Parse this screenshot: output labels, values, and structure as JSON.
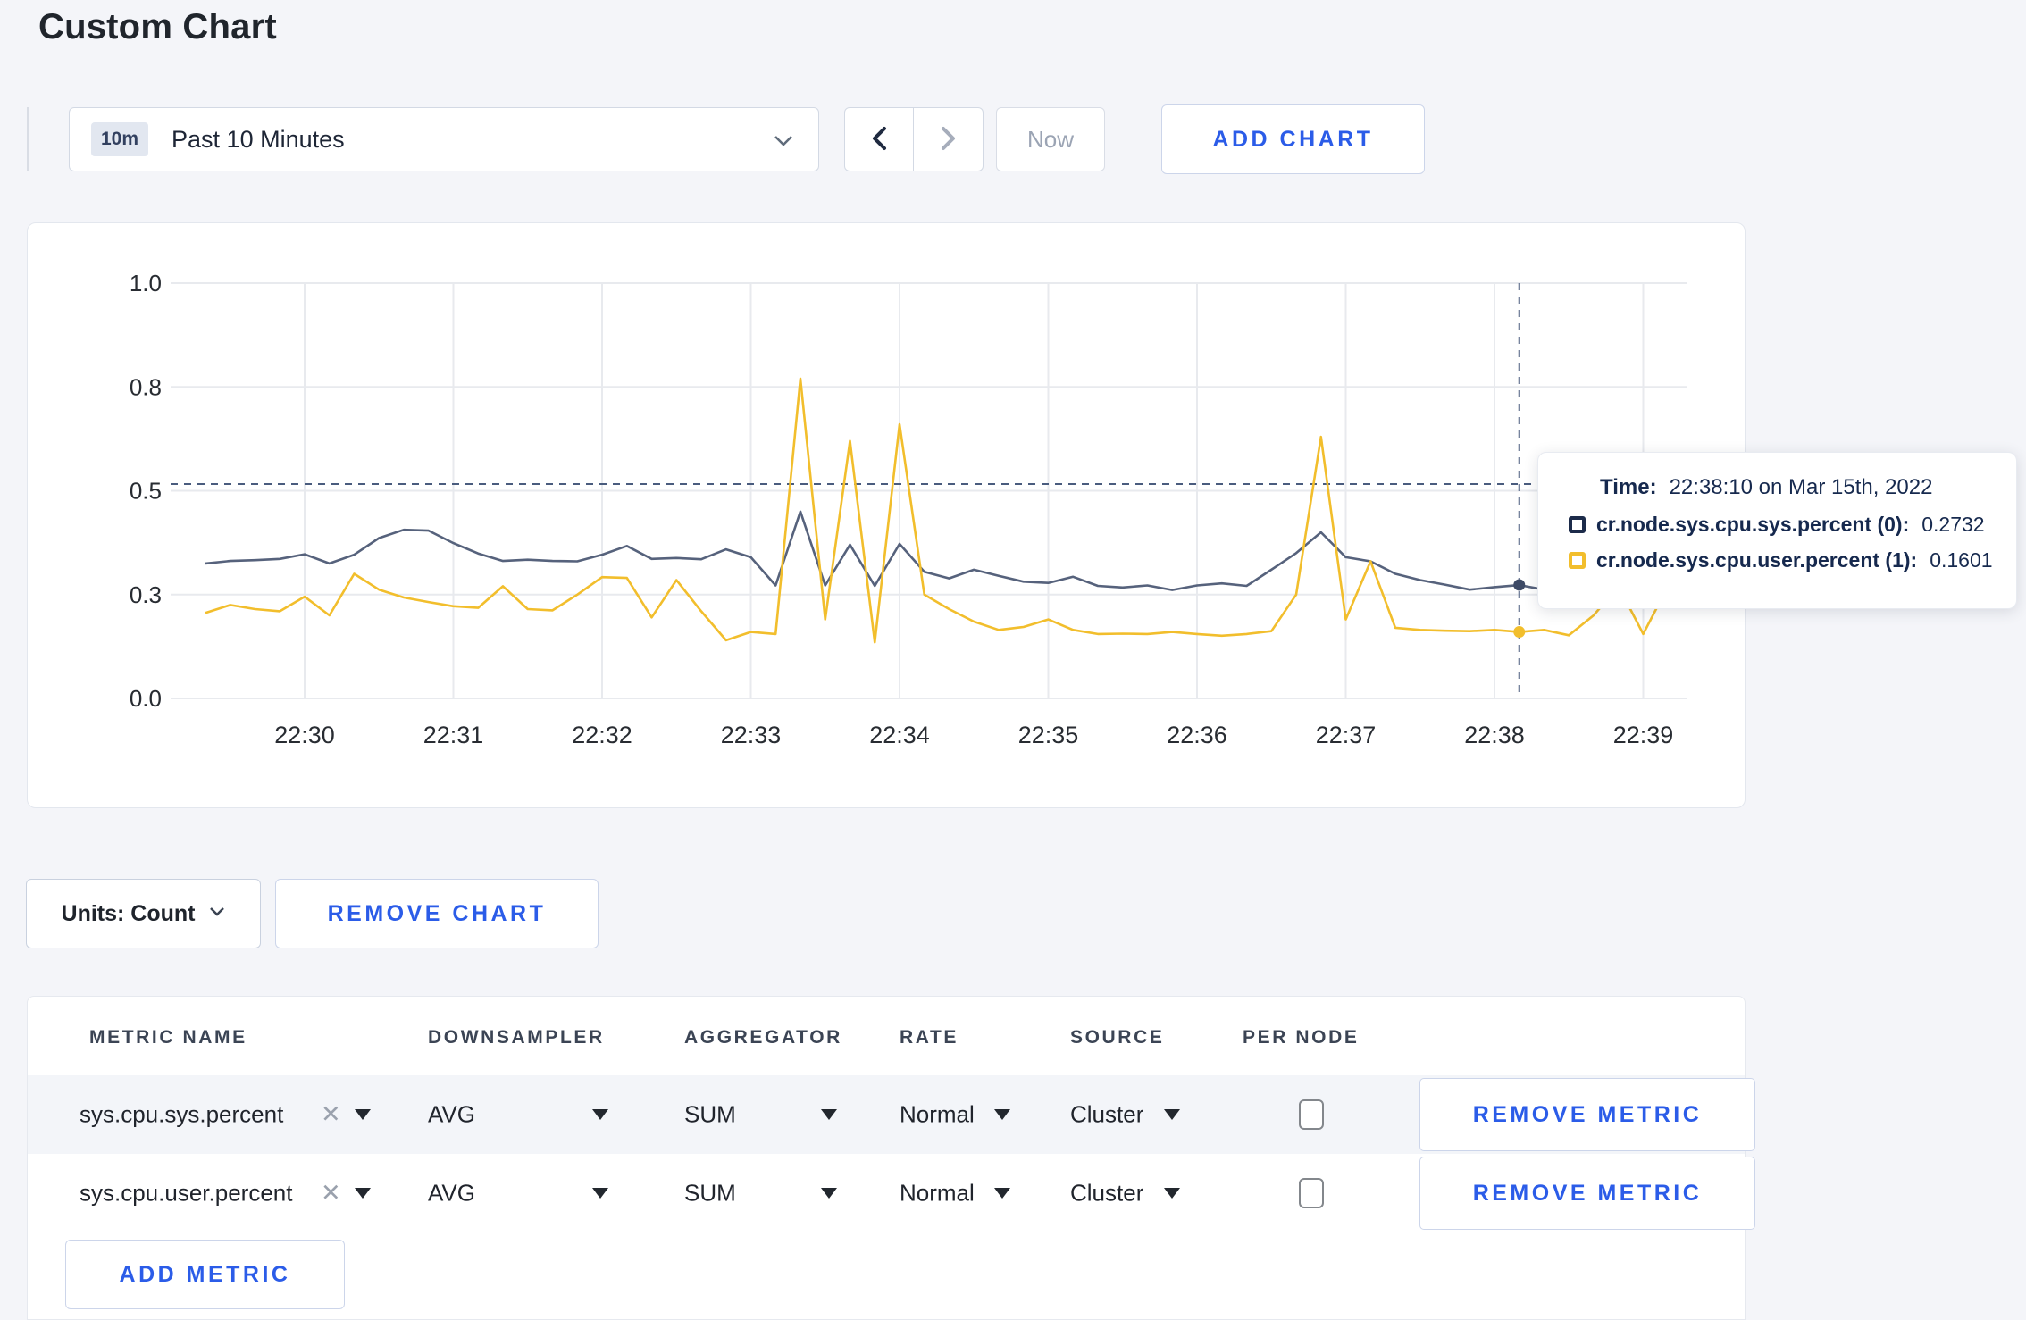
{
  "page": {
    "title": "Custom Chart"
  },
  "toolbar": {
    "time_badge": "10m",
    "time_label": "Past 10 Minutes",
    "now_label": "Now",
    "add_chart_label": "ADD CHART"
  },
  "tooltip": {
    "time_label": "Time:",
    "time_value": "22:38:10 on Mar 15th, 2022",
    "rows": [
      {
        "name": "cr.node.sys.cpu.sys.percent (0):",
        "value": "0.2732",
        "color": "#1c2b4a"
      },
      {
        "name": "cr.node.sys.cpu.user.percent (1):",
        "value": "0.1601",
        "color": "#f2be2c"
      }
    ]
  },
  "chart_footer": {
    "units_label": "Units: Count",
    "remove_chart_label": "REMOVE CHART"
  },
  "table": {
    "headers": [
      "METRIC NAME",
      "DOWNSAMPLER",
      "AGGREGATOR",
      "RATE",
      "SOURCE",
      "PER NODE"
    ],
    "rows": [
      {
        "metric": "sys.cpu.sys.percent",
        "remove_x": "✕",
        "downsampler": "AVG",
        "aggregator": "SUM",
        "rate": "Normal",
        "source": "Cluster",
        "per_node_checked": false,
        "remove_label": "REMOVE METRIC"
      },
      {
        "metric": "sys.cpu.user.percent",
        "remove_x": "✕",
        "downsampler": "AVG",
        "aggregator": "SUM",
        "rate": "Normal",
        "source": "Cluster",
        "per_node_checked": false,
        "remove_label": "REMOVE METRIC"
      }
    ],
    "add_metric_label": "ADD METRIC"
  },
  "chart_data": {
    "type": "line",
    "title": "",
    "xlabel": "",
    "ylabel": "",
    "start_time": "22:29:20",
    "interval_seconds": 10,
    "x_ticks": [
      "22:30",
      "22:31",
      "22:32",
      "22:33",
      "22:34",
      "22:35",
      "22:36",
      "22:37",
      "22:38",
      "22:39"
    ],
    "y_tick_labels": [
      "1.0",
      "0.8",
      "0.5",
      "0.3",
      "0.0"
    ],
    "y_tick_positions": [
      1.0,
      0.75,
      0.5,
      0.25,
      0.0
    ],
    "ylim": [
      0,
      1
    ],
    "grid": true,
    "series": [
      {
        "name": "cr.node.sys.cpu.sys.percent",
        "color": "#56627c",
        "values": [
          0.325,
          0.331,
          0.333,
          0.336,
          0.347,
          0.325,
          0.346,
          0.386,
          0.406,
          0.404,
          0.374,
          0.349,
          0.331,
          0.334,
          0.331,
          0.33,
          0.346,
          0.367,
          0.336,
          0.338,
          0.335,
          0.359,
          0.34,
          0.272,
          0.45,
          0.272,
          0.37,
          0.271,
          0.372,
          0.305,
          0.289,
          0.31,
          0.295,
          0.281,
          0.278,
          0.293,
          0.271,
          0.267,
          0.272,
          0.261,
          0.272,
          0.277,
          0.271,
          0.31,
          0.35,
          0.4,
          0.34,
          0.33,
          0.3,
          0.285,
          0.274,
          0.262,
          0.268,
          0.273,
          0.262,
          0.272,
          0.258,
          0.262,
          0.262,
          0.275
        ]
      },
      {
        "name": "cr.node.sys.cpu.user.percent",
        "color": "#f2be2c",
        "values": [
          0.206,
          0.225,
          0.215,
          0.21,
          0.245,
          0.2,
          0.3,
          0.262,
          0.243,
          0.232,
          0.222,
          0.218,
          0.27,
          0.215,
          0.212,
          0.25,
          0.292,
          0.29,
          0.195,
          0.285,
          0.21,
          0.14,
          0.16,
          0.155,
          0.77,
          0.19,
          0.62,
          0.135,
          0.66,
          0.25,
          0.215,
          0.185,
          0.165,
          0.172,
          0.19,
          0.165,
          0.155,
          0.156,
          0.155,
          0.16,
          0.155,
          0.151,
          0.155,
          0.162,
          0.25,
          0.63,
          0.19,
          0.33,
          0.17,
          0.165,
          0.163,
          0.162,
          0.165,
          0.16,
          0.165,
          0.152,
          0.2,
          0.27,
          0.155,
          0.27
        ]
      }
    ],
    "crosshair": {
      "time_index": 53,
      "time": "22:38:10",
      "hline_value": 0.516,
      "point_values": [
        0.2732,
        0.1601
      ]
    },
    "legend_position": "tooltip",
    "colors": {
      "grid": "#e8eaee",
      "axis_text": "#282c32",
      "crosshair": "#4a5c7e"
    }
  }
}
